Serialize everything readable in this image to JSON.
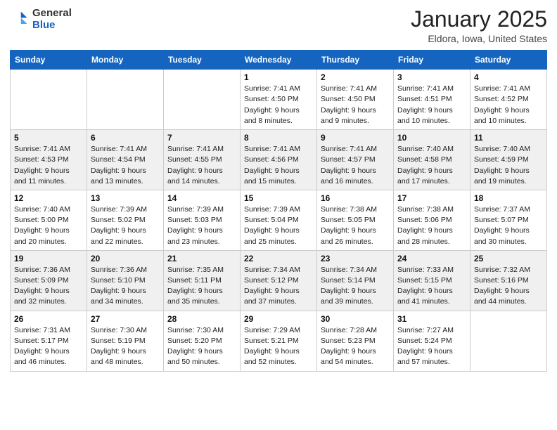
{
  "header": {
    "logo_general": "General",
    "logo_blue": "Blue",
    "month_title": "January 2025",
    "location": "Eldora, Iowa, United States"
  },
  "weekdays": [
    "Sunday",
    "Monday",
    "Tuesday",
    "Wednesday",
    "Thursday",
    "Friday",
    "Saturday"
  ],
  "weeks": [
    [
      {
        "day": "",
        "info": ""
      },
      {
        "day": "",
        "info": ""
      },
      {
        "day": "",
        "info": ""
      },
      {
        "day": "1",
        "info": "Sunrise: 7:41 AM\nSunset: 4:50 PM\nDaylight: 9 hours\nand 8 minutes."
      },
      {
        "day": "2",
        "info": "Sunrise: 7:41 AM\nSunset: 4:50 PM\nDaylight: 9 hours\nand 9 minutes."
      },
      {
        "day": "3",
        "info": "Sunrise: 7:41 AM\nSunset: 4:51 PM\nDaylight: 9 hours\nand 10 minutes."
      },
      {
        "day": "4",
        "info": "Sunrise: 7:41 AM\nSunset: 4:52 PM\nDaylight: 9 hours\nand 10 minutes."
      }
    ],
    [
      {
        "day": "5",
        "info": "Sunrise: 7:41 AM\nSunset: 4:53 PM\nDaylight: 9 hours\nand 11 minutes."
      },
      {
        "day": "6",
        "info": "Sunrise: 7:41 AM\nSunset: 4:54 PM\nDaylight: 9 hours\nand 13 minutes."
      },
      {
        "day": "7",
        "info": "Sunrise: 7:41 AM\nSunset: 4:55 PM\nDaylight: 9 hours\nand 14 minutes."
      },
      {
        "day": "8",
        "info": "Sunrise: 7:41 AM\nSunset: 4:56 PM\nDaylight: 9 hours\nand 15 minutes."
      },
      {
        "day": "9",
        "info": "Sunrise: 7:41 AM\nSunset: 4:57 PM\nDaylight: 9 hours\nand 16 minutes."
      },
      {
        "day": "10",
        "info": "Sunrise: 7:40 AM\nSunset: 4:58 PM\nDaylight: 9 hours\nand 17 minutes."
      },
      {
        "day": "11",
        "info": "Sunrise: 7:40 AM\nSunset: 4:59 PM\nDaylight: 9 hours\nand 19 minutes."
      }
    ],
    [
      {
        "day": "12",
        "info": "Sunrise: 7:40 AM\nSunset: 5:00 PM\nDaylight: 9 hours\nand 20 minutes."
      },
      {
        "day": "13",
        "info": "Sunrise: 7:39 AM\nSunset: 5:02 PM\nDaylight: 9 hours\nand 22 minutes."
      },
      {
        "day": "14",
        "info": "Sunrise: 7:39 AM\nSunset: 5:03 PM\nDaylight: 9 hours\nand 23 minutes."
      },
      {
        "day": "15",
        "info": "Sunrise: 7:39 AM\nSunset: 5:04 PM\nDaylight: 9 hours\nand 25 minutes."
      },
      {
        "day": "16",
        "info": "Sunrise: 7:38 AM\nSunset: 5:05 PM\nDaylight: 9 hours\nand 26 minutes."
      },
      {
        "day": "17",
        "info": "Sunrise: 7:38 AM\nSunset: 5:06 PM\nDaylight: 9 hours\nand 28 minutes."
      },
      {
        "day": "18",
        "info": "Sunrise: 7:37 AM\nSunset: 5:07 PM\nDaylight: 9 hours\nand 30 minutes."
      }
    ],
    [
      {
        "day": "19",
        "info": "Sunrise: 7:36 AM\nSunset: 5:09 PM\nDaylight: 9 hours\nand 32 minutes."
      },
      {
        "day": "20",
        "info": "Sunrise: 7:36 AM\nSunset: 5:10 PM\nDaylight: 9 hours\nand 34 minutes."
      },
      {
        "day": "21",
        "info": "Sunrise: 7:35 AM\nSunset: 5:11 PM\nDaylight: 9 hours\nand 35 minutes."
      },
      {
        "day": "22",
        "info": "Sunrise: 7:34 AM\nSunset: 5:12 PM\nDaylight: 9 hours\nand 37 minutes."
      },
      {
        "day": "23",
        "info": "Sunrise: 7:34 AM\nSunset: 5:14 PM\nDaylight: 9 hours\nand 39 minutes."
      },
      {
        "day": "24",
        "info": "Sunrise: 7:33 AM\nSunset: 5:15 PM\nDaylight: 9 hours\nand 41 minutes."
      },
      {
        "day": "25",
        "info": "Sunrise: 7:32 AM\nSunset: 5:16 PM\nDaylight: 9 hours\nand 44 minutes."
      }
    ],
    [
      {
        "day": "26",
        "info": "Sunrise: 7:31 AM\nSunset: 5:17 PM\nDaylight: 9 hours\nand 46 minutes."
      },
      {
        "day": "27",
        "info": "Sunrise: 7:30 AM\nSunset: 5:19 PM\nDaylight: 9 hours\nand 48 minutes."
      },
      {
        "day": "28",
        "info": "Sunrise: 7:30 AM\nSunset: 5:20 PM\nDaylight: 9 hours\nand 50 minutes."
      },
      {
        "day": "29",
        "info": "Sunrise: 7:29 AM\nSunset: 5:21 PM\nDaylight: 9 hours\nand 52 minutes."
      },
      {
        "day": "30",
        "info": "Sunrise: 7:28 AM\nSunset: 5:23 PM\nDaylight: 9 hours\nand 54 minutes."
      },
      {
        "day": "31",
        "info": "Sunrise: 7:27 AM\nSunset: 5:24 PM\nDaylight: 9 hours\nand 57 minutes."
      },
      {
        "day": "",
        "info": ""
      }
    ]
  ]
}
